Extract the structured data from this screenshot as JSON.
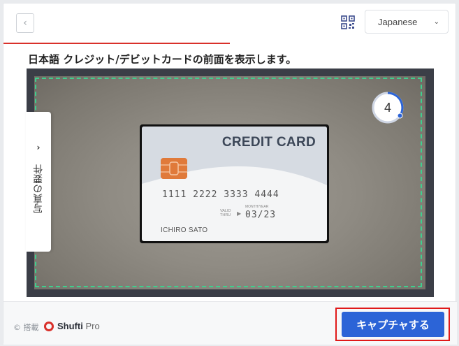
{
  "header": {
    "back_icon": "‹",
    "language": "Japanese",
    "language_chevron": "⌄"
  },
  "instruction": "日本語 クレジット/デビットカードの前面を表示します。",
  "camera": {
    "countdown": "4",
    "card": {
      "title": "CREDIT CARD",
      "number": "1111  2222  3333  4444",
      "valid_thru_label": "VALID THRU",
      "month_year_label": "MONTH/YEAR",
      "expiry": "03/23",
      "holder": "ICHIRO SATO"
    },
    "requirements_chevron": "›",
    "requirements_label": "写真の要件"
  },
  "footer": {
    "powered_by": "© 搭載",
    "brand_bold": "Shufti",
    "brand_light": "Pro",
    "capture_label": "キャプチャする"
  },
  "colors": {
    "accent": "#2c64d7",
    "progress": "#d9302a",
    "guide": "#3fcf8e",
    "highlight": "#e01919"
  }
}
